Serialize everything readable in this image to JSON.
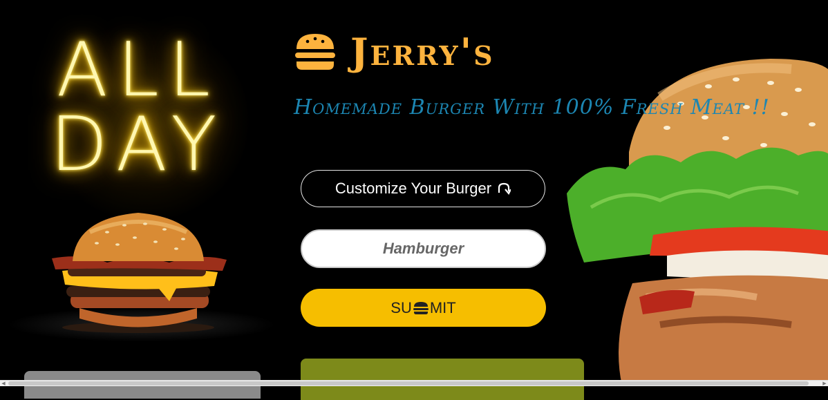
{
  "left_art": {
    "line1": "ALL",
    "line2": "DAY"
  },
  "brand": {
    "name": "Jerry's",
    "icon": "burger-icon",
    "color": "#fdb33e"
  },
  "tagline": {
    "text": "Homemade Burger With 100% Fresh Meat !!",
    "color": "#1c86b2"
  },
  "customize": {
    "label": "Customize Your Burger",
    "icon": "curved-arrow-down-icon"
  },
  "burger_input": {
    "value": "Hamburger",
    "placeholder": ""
  },
  "submit": {
    "prefix": "SU",
    "suffix": "MIT",
    "icon": "burger-icon",
    "color": "#f6be00"
  },
  "result": {
    "text": ""
  },
  "colors": {
    "background": "#000000",
    "result_panel": "#7d8a1a",
    "side_card": "#8a8a8a"
  }
}
